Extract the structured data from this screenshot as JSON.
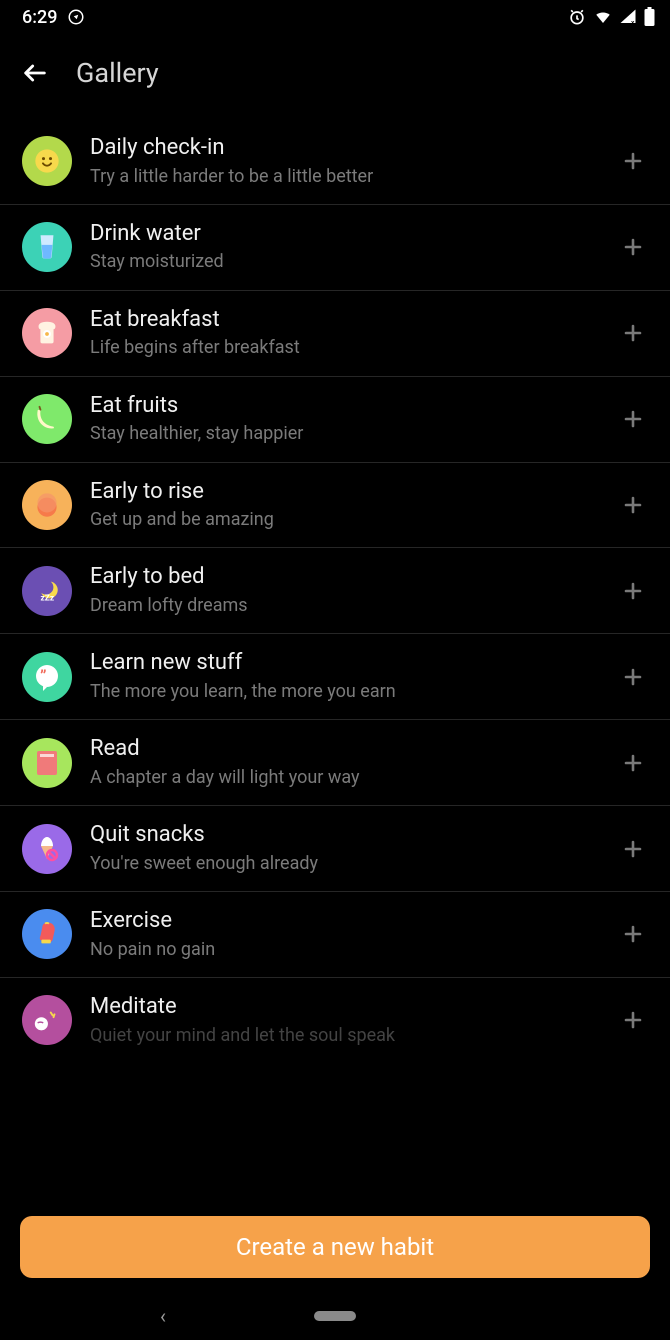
{
  "status": {
    "time": "6:29"
  },
  "header": {
    "title": "Gallery"
  },
  "cta": {
    "label": "Create a new habit"
  },
  "habits": [
    {
      "id": "daily-check-in",
      "title": "Daily check-in",
      "subtitle": "Try a little harder to be a little better",
      "icon_bg": "#b3d94b",
      "icon": "smile"
    },
    {
      "id": "drink-water",
      "title": "Drink water",
      "subtitle": "Stay moisturized",
      "icon_bg": "#3cd2b6",
      "icon": "glass"
    },
    {
      "id": "eat-breakfast",
      "title": "Eat breakfast",
      "subtitle": "Life begins after breakfast",
      "icon_bg": "#f59ca4",
      "icon": "toast"
    },
    {
      "id": "eat-fruits",
      "title": "Eat fruits",
      "subtitle": "Stay healthier, stay happier",
      "icon_bg": "#7fe96b",
      "icon": "banana"
    },
    {
      "id": "early-to-rise",
      "title": "Early to rise",
      "subtitle": "Get up and be amazing",
      "icon_bg": "#f7b25a",
      "icon": "sun"
    },
    {
      "id": "early-to-bed",
      "title": "Early to bed",
      "subtitle": "Dream lofty dreams",
      "icon_bg": "#6b4fb3",
      "icon": "moon"
    },
    {
      "id": "learn-new-stuff",
      "title": "Learn new stuff",
      "subtitle": "The more you learn, the more you earn",
      "icon_bg": "#3fd6a0",
      "icon": "quote"
    },
    {
      "id": "read",
      "title": "Read",
      "subtitle": "A chapter a day will light your way",
      "icon_bg": "#a7e65d",
      "icon": "book"
    },
    {
      "id": "quit-snacks",
      "title": "Quit snacks",
      "subtitle": "You're sweet enough already",
      "icon_bg": "#9a6ae8",
      "icon": "icecream"
    },
    {
      "id": "exercise",
      "title": "Exercise",
      "subtitle": "No pain no gain",
      "icon_bg": "#4a8cef",
      "icon": "glove"
    },
    {
      "id": "meditate",
      "title": "Meditate",
      "subtitle": "Quiet your mind and let the soul speak",
      "icon_bg": "#b44f9e",
      "icon": "meditate"
    }
  ]
}
